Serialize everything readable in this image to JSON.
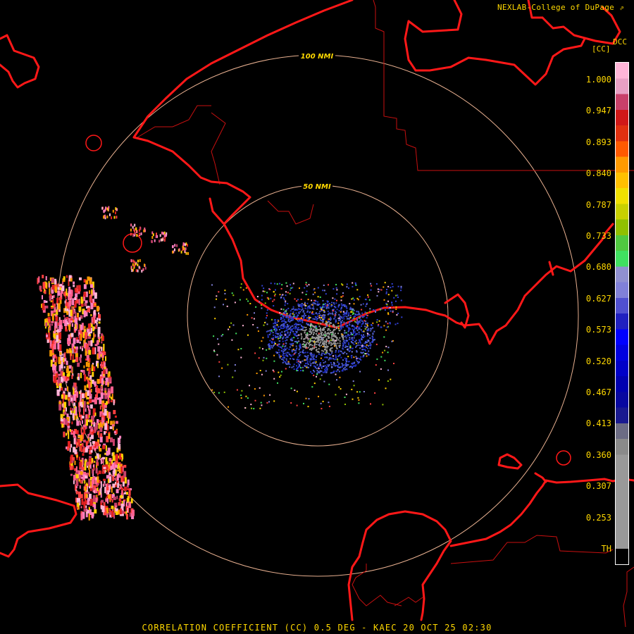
{
  "header": {
    "credit": "NEXLAB-College of DuPage",
    "product_code": "DCC",
    "unit": "[CC]"
  },
  "rings": [
    {
      "label": "100 NMI"
    },
    {
      "label": "50 NMI"
    }
  ],
  "colorbar": {
    "ticks": [
      "1.000",
      "0.947",
      "0.893",
      "0.840",
      "0.787",
      "0.733",
      "0.680",
      "0.627",
      "0.573",
      "0.520",
      "0.467",
      "0.413",
      "0.360",
      "0.307",
      "0.253",
      "TH"
    ],
    "colors": [
      "#ffb6d8",
      "#e8a0c4",
      "#c8406a",
      "#d01818",
      "#e03010",
      "#ff5a00",
      "#ff9a00",
      "#ffc000",
      "#f0e000",
      "#c8d000",
      "#90c000",
      "#50c840",
      "#40e060",
      "#9090d0",
      "#8080d8",
      "#5050d0",
      "#2020c0",
      "#0000ff",
      "#0000e0",
      "#0000c8",
      "#0000b0",
      "#0808a0",
      "#1a1a90",
      "#6c6c84",
      "#8a8a8a",
      "#999999",
      "#999999",
      "#999999",
      "#999999",
      "#999999",
      "#999999",
      "#000000"
    ]
  },
  "footer": {
    "title": "CORRELATION COEFFICIENT (CC) 0.5 DEG - KAEC 20 OCT 25 02:30"
  },
  "colors": {
    "coast": "#ff1818",
    "boundary": "#c81010",
    "ring": "#e8b090",
    "text": "#ffd800"
  }
}
